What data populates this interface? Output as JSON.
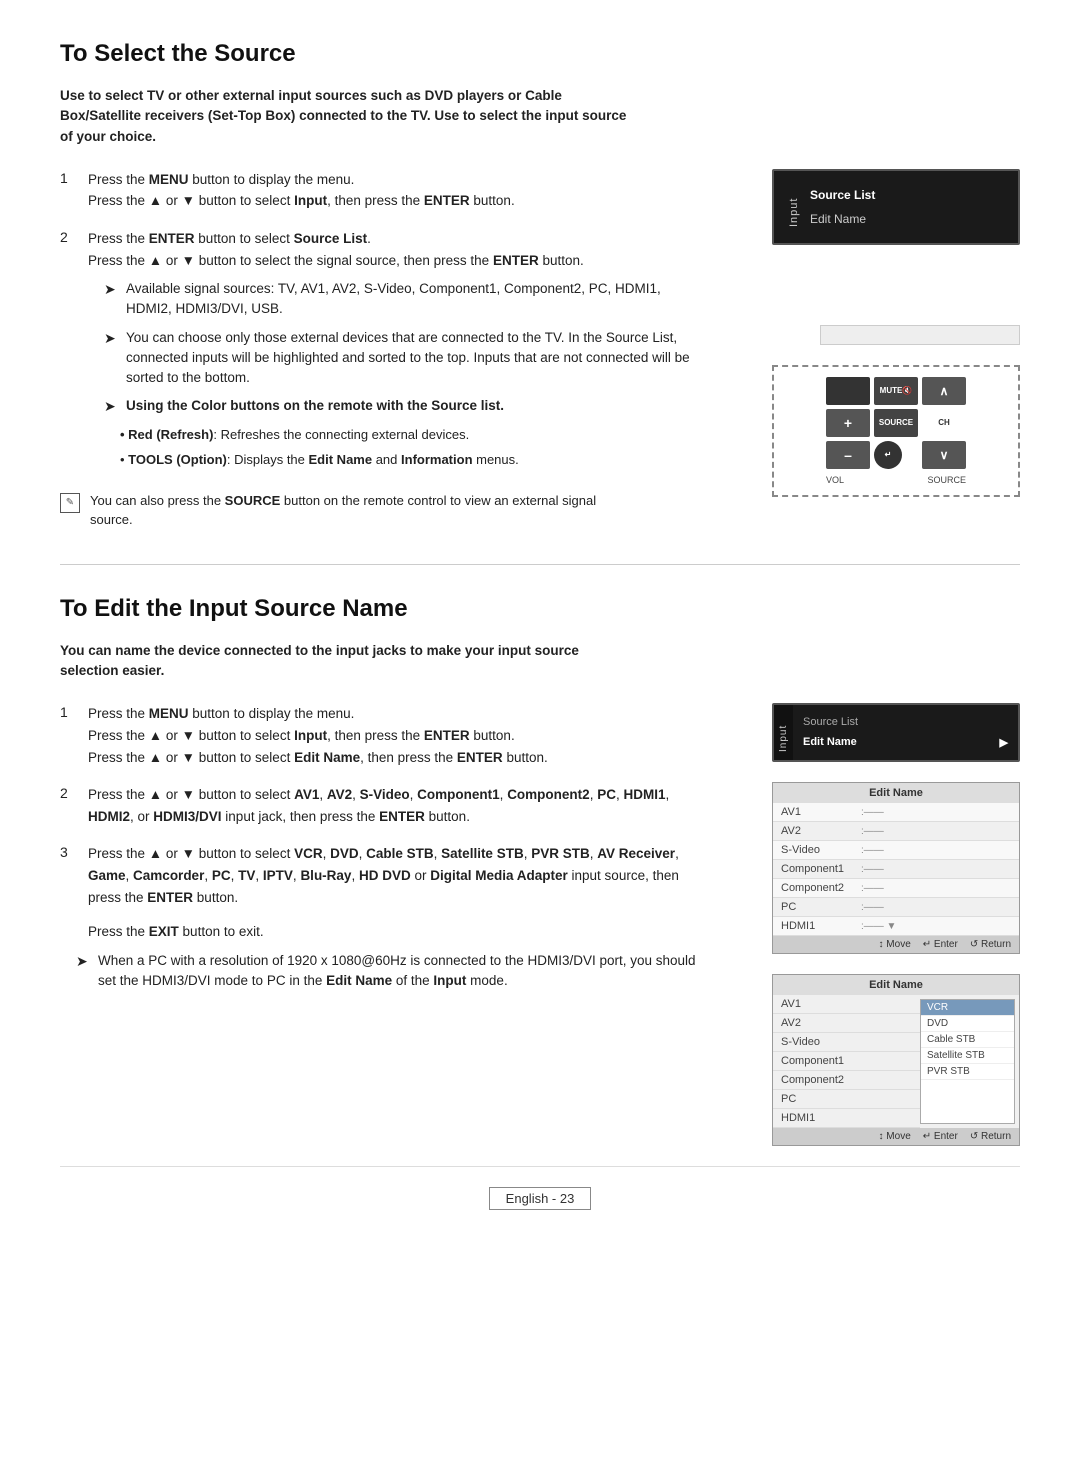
{
  "section1": {
    "title": "To Select the Source",
    "intro": "Use to select TV or other external input sources such as DVD players or Cable Box/Satellite receivers (Set-Top Box) connected to the TV. Use to select the input source of your choice.",
    "step1": {
      "num": "1",
      "line1": "Press the ",
      "bold1": "MENU",
      "line1b": " button to display the menu.",
      "line2_pre": "Press the ▲ or ▼ button to select ",
      "bold2": "Input",
      "line2b": ", then press the ",
      "bold3": "ENTER",
      "line2c": " button."
    },
    "step2": {
      "num": "2",
      "line1_pre": "Press the ",
      "bold1": "ENTER",
      "line1b": " button to select ",
      "bold2": "Source List",
      "line1c": ".",
      "line2_pre": "Press the ▲ or ▼ button to select the signal source, then press the ",
      "bold2b": "ENTER",
      "line2b": " button.",
      "arrow1": "Available signal sources: TV, AV1, AV2, S-Video, Component1, Component2, PC, HDMI1, HDMI2, HDMI3/DVI, USB.",
      "arrow2": "You can choose only those external devices that are connected to the TV. In the Source List, connected inputs will be highlighted and sorted to the top. Inputs that are not connected will be sorted to the bottom.",
      "arrow3_bold": "Using the Color buttons on the remote with the Source list.",
      "sub1_pre": "• Red (Refresh)",
      "sub1b": ": Refreshes the connecting external devices.",
      "sub2_pre": "• TOOLS (Option)",
      "sub2b": ": Displays the ",
      "sub2_bold": "Edit Name",
      "sub2c": " and ",
      "sub2_bold2": "Information",
      "sub2d": " menus."
    },
    "note_pre": "You can also press the ",
    "note_bold": "SOURCE",
    "note_post": " button on the remote control to view an external signal source.",
    "menu1": {
      "vertical_label": "Input",
      "items": [
        "Source List",
        "Edit Name"
      ]
    }
  },
  "section2": {
    "title": "To Edit the Input Source Name",
    "intro": "You can name the device connected to the input jacks to make your input source selection easier.",
    "step1": {
      "num": "1",
      "line1": "Press the ",
      "bold1": "MENU",
      "line1b": " button to display the menu.",
      "line2_pre": "Press the ▲ or ▼ button to select ",
      "bold2": "Input",
      "line2b": ", then press the ",
      "bold3": "ENTER",
      "line2c": " button.",
      "line3_pre": "Press the ▲ or ▼ button to select ",
      "bold4": "Edit Name",
      "line3b": ", then press the ",
      "bold5": "ENTER",
      "line3c": " button."
    },
    "step2": {
      "num": "2",
      "line1_pre": "Press the ▲ or ▼ button to select ",
      "bold1": "AV1",
      "sep1": ", ",
      "bold2": "AV2",
      "sep2": ", ",
      "bold3": "S-Video",
      "sep3": ", ",
      "bold4": "Component1",
      "sep4": ", ",
      "bold5": "Component2",
      "sep5": ", ",
      "bold6": "PC",
      "sep6": ", ",
      "bold7": "HDMI1",
      "sep7": ", ",
      "bold8": "HDMI2",
      "sep8": ", or ",
      "bold9": "HDMI3/DVI",
      "line1b": " input jack, then press the ",
      "bold10": "ENTER",
      "line1c": " button."
    },
    "step3": {
      "num": "3",
      "line1_pre": "Press the ▲ or ▼ button to select ",
      "bold1": "VCR",
      "sep1": ", ",
      "bold2": "DVD",
      "sep2": ", ",
      "bold3": "Cable STB",
      "sep3": ", ",
      "bold4": "Satellite STB",
      "sep4": ", ",
      "bold5": "PVR STB",
      "sep5": ", ",
      "bold6": "AV Receiver",
      "sep6": ", ",
      "bold7": "Game",
      "sep7": ", ",
      "bold8": "Camcorder",
      "sep8": ", ",
      "bold9": "PC",
      "sep9": ", ",
      "bold10": "TV",
      "sep10": ", ",
      "bold11": "IPTV",
      "sep11": ", ",
      "bold12": "Blu-Ray",
      "sep12": ", ",
      "bold13": "HD DVD",
      "sep13": " or ",
      "bold14": "Digital Media Adapter",
      "line1b": " input source, then press the ",
      "bold15": "ENTER",
      "line1c": " button."
    },
    "exit_pre": "Press the ",
    "exit_bold": "EXIT",
    "exit_post": " button to exit.",
    "arrow1_pre": "When a PC with a resolution of 1920 x 1080@60Hz is connected to the HDMI3/DVI port, you should set the HDMI3/DVI mode to PC in the ",
    "arrow1_bold": "Edit",
    "arrow1_mid": "\n",
    "arrow1_bold2": "Name",
    "arrow1b": " of the ",
    "arrow1_bold3": "Input",
    "arrow1c": " mode.",
    "menu2": {
      "vertical_label": "Input",
      "header": "Source List",
      "selected_item": "Edit Name",
      "arrow": "▶"
    },
    "edit_name_table": {
      "header": "Edit Name",
      "rows": [
        {
          "label": "AV1",
          "value": " :——"
        },
        {
          "label": "AV2",
          "value": " :——"
        },
        {
          "label": "S-Video",
          "value": " :——"
        },
        {
          "label": "Component1",
          "value": " :——"
        },
        {
          "label": "Component2",
          "value": " :——"
        },
        {
          "label": "PC",
          "value": " :——"
        },
        {
          "label": "HDMI1",
          "value": " :——"
        }
      ],
      "footer": "↕ Move    ↵ Enter    ↺ Return"
    },
    "edit_name_table2": {
      "header": "Edit Name",
      "rows": [
        {
          "label": "AV1",
          "value": ""
        },
        {
          "label": "AV2",
          "value": ""
        },
        {
          "label": "S-Video",
          "value": ""
        },
        {
          "label": "Component1",
          "value": ""
        },
        {
          "label": "Component2",
          "value": ""
        },
        {
          "label": "PC",
          "value": ""
        },
        {
          "label": "HDMI1",
          "value": ""
        }
      ],
      "options": [
        "VCR",
        "DVD",
        "Cable STB",
        "Satellite STB",
        "PVR STB"
      ],
      "selected_option": "VCR",
      "footer": "↕ Move    ↵ Enter    ↺ Return"
    }
  },
  "footer": {
    "label": "English - 23"
  },
  "remote": {
    "mute_label": "MUTE",
    "vol_label": "VOL",
    "source_label": "SOURCE",
    "ch_label": "CH",
    "plus": "+",
    "minus": "–",
    "up": "∧",
    "down": "∨",
    "enter_sym": "↵"
  }
}
